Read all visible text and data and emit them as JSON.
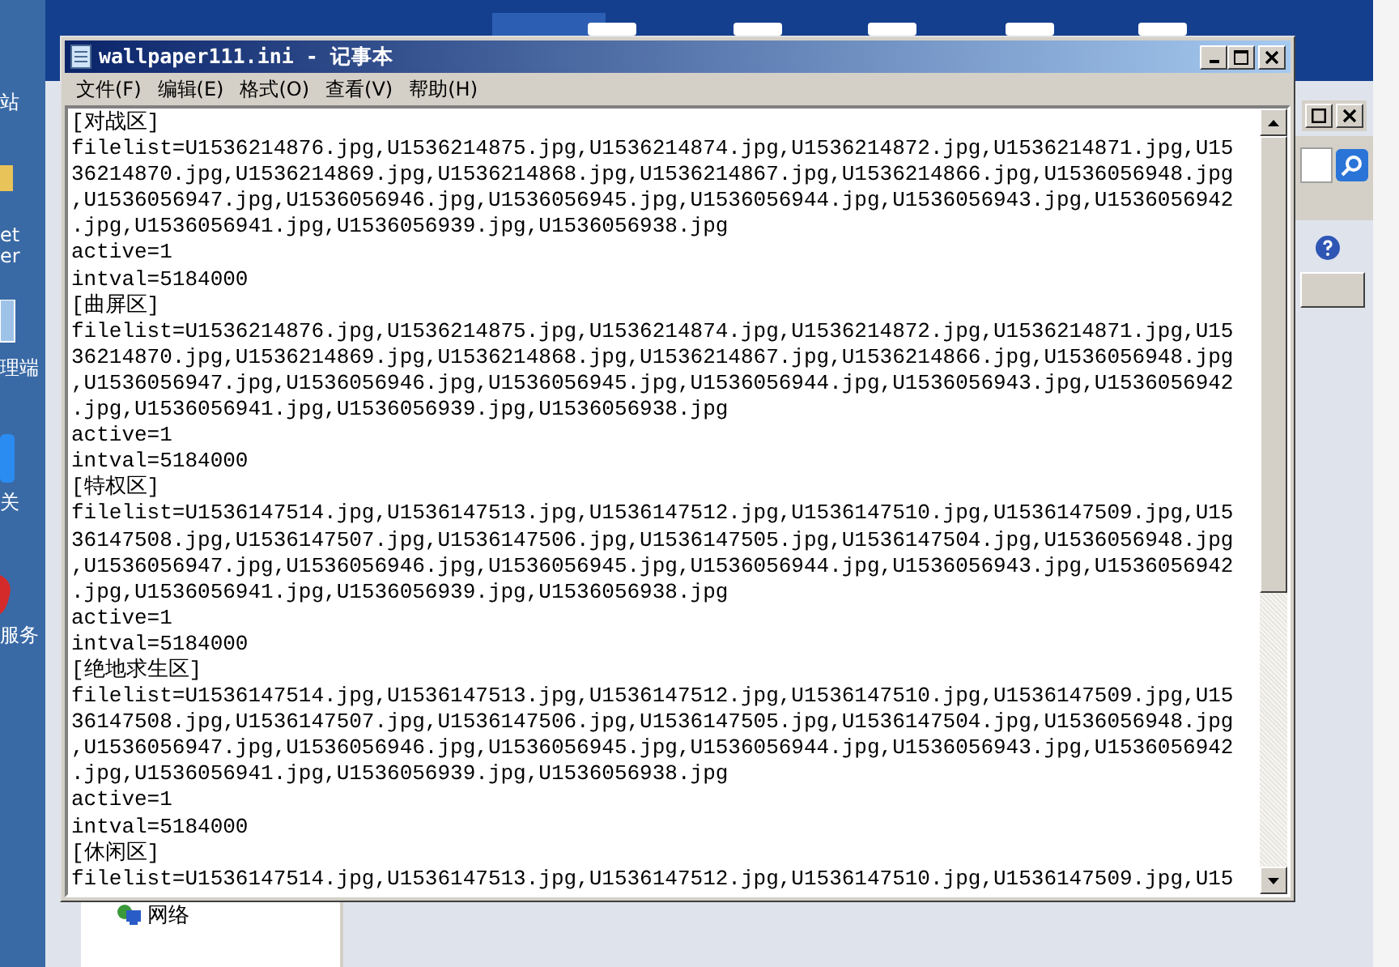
{
  "desktop": {
    "labels": [
      "站",
      "et",
      "er",
      "理端",
      "关",
      "服务"
    ]
  },
  "back_window": {
    "tree_item": "网络"
  },
  "notepad": {
    "title": "wallpaper111.ini - 记事本",
    "menu": [
      "文件(F)",
      "编辑(E)",
      "格式(O)",
      "查看(V)",
      "帮助(H)"
    ],
    "lines": [
      "[对战区]",
      "filelist=U1536214876.jpg,U1536214875.jpg,U1536214874.jpg,U1536214872.jpg,U1536214871.jpg,U15",
      "36214870.jpg,U1536214869.jpg,U1536214868.jpg,U1536214867.jpg,U1536214866.jpg,U1536056948.jpg",
      ",U1536056947.jpg,U1536056946.jpg,U1536056945.jpg,U1536056944.jpg,U1536056943.jpg,U1536056942",
      ".jpg,U1536056941.jpg,U1536056939.jpg,U1536056938.jpg",
      "active=1",
      "intval=5184000",
      "[曲屏区]",
      "filelist=U1536214876.jpg,U1536214875.jpg,U1536214874.jpg,U1536214872.jpg,U1536214871.jpg,U15",
      "36214870.jpg,U1536214869.jpg,U1536214868.jpg,U1536214867.jpg,U1536214866.jpg,U1536056948.jpg",
      ",U1536056947.jpg,U1536056946.jpg,U1536056945.jpg,U1536056944.jpg,U1536056943.jpg,U1536056942",
      ".jpg,U1536056941.jpg,U1536056939.jpg,U1536056938.jpg",
      "active=1",
      "intval=5184000",
      "[特权区]",
      "filelist=U1536147514.jpg,U1536147513.jpg,U1536147512.jpg,U1536147510.jpg,U1536147509.jpg,U15",
      "36147508.jpg,U1536147507.jpg,U1536147506.jpg,U1536147505.jpg,U1536147504.jpg,U1536056948.jpg",
      ",U1536056947.jpg,U1536056946.jpg,U1536056945.jpg,U1536056944.jpg,U1536056943.jpg,U1536056942",
      ".jpg,U1536056941.jpg,U1536056939.jpg,U1536056938.jpg",
      "active=1",
      "intval=5184000",
      "[绝地求生区]",
      "filelist=U1536147514.jpg,U1536147513.jpg,U1536147512.jpg,U1536147510.jpg,U1536147509.jpg,U15",
      "36147508.jpg,U1536147507.jpg,U1536147506.jpg,U1536147505.jpg,U1536147504.jpg,U1536056948.jpg",
      ",U1536056947.jpg,U1536056946.jpg,U1536056945.jpg,U1536056944.jpg,U1536056943.jpg,U1536056942",
      ".jpg,U1536056941.jpg,U1536056939.jpg,U1536056938.jpg",
      "active=1",
      "intval=5184000",
      "[休闲区]",
      "filelist=U1536147514.jpg,U1536147513.jpg,U1536147512.jpg,U1536147510.jpg,U1536147509.jpg,U15"
    ]
  }
}
